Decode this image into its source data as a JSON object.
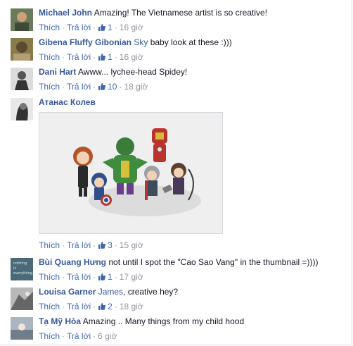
{
  "comments": [
    {
      "author": "Michael John",
      "text": "Amazing! The Vietnamese artist is so creative!",
      "like_label": "Thích",
      "reply_label": "Trả lời",
      "likes": "1",
      "time": "16 giờ",
      "avatar_color": "#6b7a5a"
    },
    {
      "author": "Gibena Fluffy Gibonian",
      "tagged": "Sky",
      "text": " baby look at these :)))",
      "like_label": "Thích",
      "reply_label": "Trả lời",
      "likes": "1",
      "time": "16 giờ",
      "avatar_color": "#8a7a4a"
    },
    {
      "author": "Dani Hart",
      "text": "Awww... lychee-head Spidey!",
      "like_label": "Thích",
      "reply_label": "Trả lời",
      "likes": "10",
      "time": "18 giờ",
      "avatar_color": "#777777"
    },
    {
      "author": "Атанас Колев",
      "has_photo": true,
      "like_label": "Thích",
      "reply_label": "Trả lời",
      "likes": "3",
      "time": "15 giờ",
      "avatar_color": "#555555"
    },
    {
      "author": "Bùi Quang Hưng",
      "text": "not until I spot the \"Cao Sao Vang\" in the thumbnail =))))",
      "like_label": "Thích",
      "reply_label": "Trả lời",
      "likes": "1",
      "time": "17 giờ",
      "avatar_color": "#4a6a7a",
      "avatar_text": [
        "nothing",
        "is",
        "everything"
      ]
    },
    {
      "author": "Louisa Garner",
      "tagged": "James",
      "text": ", creative hey?",
      "like_label": "Thích",
      "reply_label": "Trả lời",
      "likes": "2",
      "time": "18 giờ",
      "avatar_color": "#888888"
    },
    {
      "author": "Tạ Mỹ Hòa",
      "text": "Amazing .. Many things from my child hood",
      "like_label": "Thích",
      "reply_label": "Trả lời",
      "time": "6 giờ",
      "avatar_color": "#7a8a9a"
    }
  ],
  "colors": {
    "link": "#365899",
    "action": "#4267b2",
    "muted": "#90949c",
    "text": "#141823"
  },
  "icons": {
    "like": "thumbs-up-icon"
  }
}
